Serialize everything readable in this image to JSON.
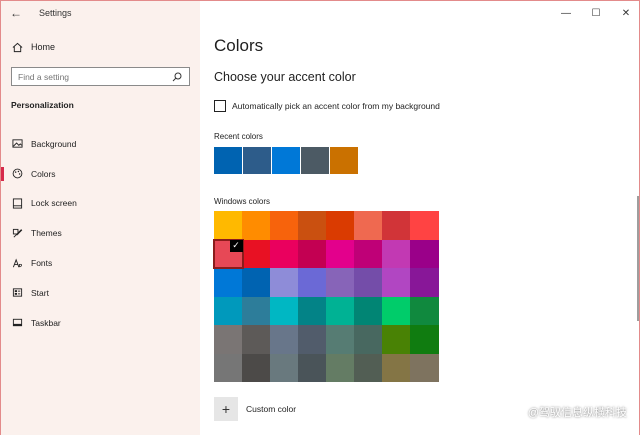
{
  "app": {
    "title": "Settings"
  },
  "sidebar": {
    "home_label": "Home",
    "search_placeholder": "Find a setting",
    "section_label": "Personalization",
    "items": [
      {
        "label": "Background",
        "icon": "picture-icon"
      },
      {
        "label": "Colors",
        "icon": "palette-icon",
        "active": true
      },
      {
        "label": "Lock screen",
        "icon": "lock-screen-icon"
      },
      {
        "label": "Themes",
        "icon": "brush-icon"
      },
      {
        "label": "Fonts",
        "icon": "font-icon"
      },
      {
        "label": "Start",
        "icon": "start-icon"
      },
      {
        "label": "Taskbar",
        "icon": "taskbar-icon"
      }
    ]
  },
  "main": {
    "page_title": "Colors",
    "subtitle": "Choose your accent color",
    "auto_pick_label": "Automatically pick an accent color from my background",
    "recent_label": "Recent colors",
    "windows_label": "Windows colors",
    "custom_label": "Custom color",
    "recent_colors": [
      "#0063b1",
      "#2d5c8a",
      "#0078d7",
      "#4c5a64",
      "#ca7100"
    ],
    "windows_colors": [
      "#ffb900",
      "#ff8c00",
      "#f7630c",
      "#ca5010",
      "#da3b01",
      "#ef6950",
      "#d13438",
      "#ff4343",
      "#e74856",
      "#e81123",
      "#ea005e",
      "#c30052",
      "#e3008c",
      "#bf0077",
      "#c239b3",
      "#9a0089",
      "#0078d7",
      "#0063b1",
      "#8e8cd8",
      "#6b69d6",
      "#8764b8",
      "#744da9",
      "#b146c2",
      "#881798",
      "#0099bc",
      "#2d7d9a",
      "#00b7c3",
      "#038387",
      "#00b294",
      "#018574",
      "#00cc6a",
      "#10893e",
      "#7a7574",
      "#5d5a58",
      "#68768a",
      "#515c6b",
      "#567c73",
      "#486860",
      "#498205",
      "#107c10",
      "#767676",
      "#4c4a48",
      "#69797e",
      "#4a5459",
      "#647c64",
      "#525e54",
      "#847545",
      "#7e735f"
    ],
    "selected_index": 8
  },
  "window_controls": {
    "minimize": "—",
    "maximize": "☐",
    "close": "✕"
  },
  "watermark": "@驾驭信息纵横科技"
}
